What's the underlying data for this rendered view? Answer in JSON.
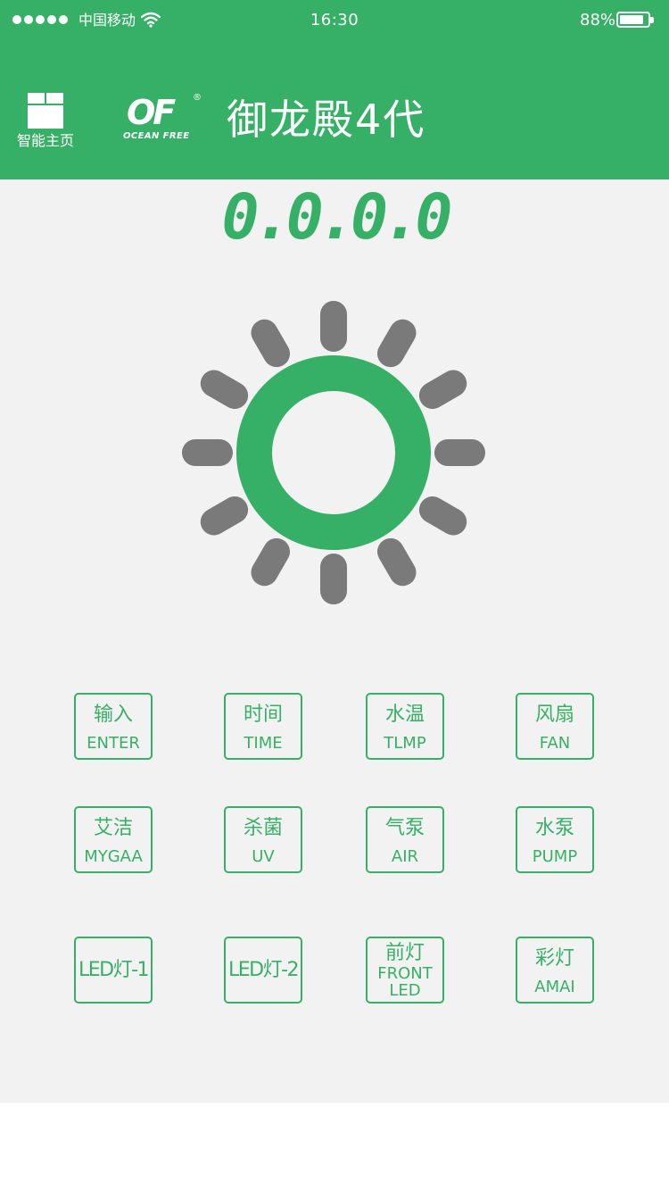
{
  "status_bar": {
    "carrier": "中国移动",
    "time": "16:30",
    "battery_percent": "88%",
    "battery_level": 0.88
  },
  "header": {
    "home_label": "智能主页",
    "logo_text": "OF",
    "logo_subtext": "OCEAN FREE",
    "logo_registered": "®",
    "title": "御龙殿4代"
  },
  "display": {
    "value": "0.0.0.0"
  },
  "colors": {
    "brand_green": "#37b067",
    "ray_gray": "#7a7a7a",
    "panel_bg": "#f2f2f2"
  },
  "buttons": {
    "enter": {
      "cn": "输入",
      "en": "ENTER"
    },
    "time": {
      "cn": "时间",
      "en": "TIME"
    },
    "water_temp": {
      "cn": "水温",
      "en": "TLMP"
    },
    "fan": {
      "cn": "风扇",
      "en": "FAN"
    },
    "mygaa": {
      "cn": "艾洁",
      "en": "MYGAA"
    },
    "uv": {
      "cn": "杀菌",
      "en": "UV"
    },
    "air": {
      "cn": "气泵",
      "en": "AIR"
    },
    "pump": {
      "cn": "水泵",
      "en": "PUMP"
    },
    "led1": {
      "label": "LED灯-1"
    },
    "led2": {
      "label": "LED灯-2"
    },
    "front_led": {
      "cn": "前灯",
      "en1": "FRONT",
      "en2": "LED"
    },
    "amai": {
      "cn": "彩灯",
      "en": "AMAI"
    }
  }
}
